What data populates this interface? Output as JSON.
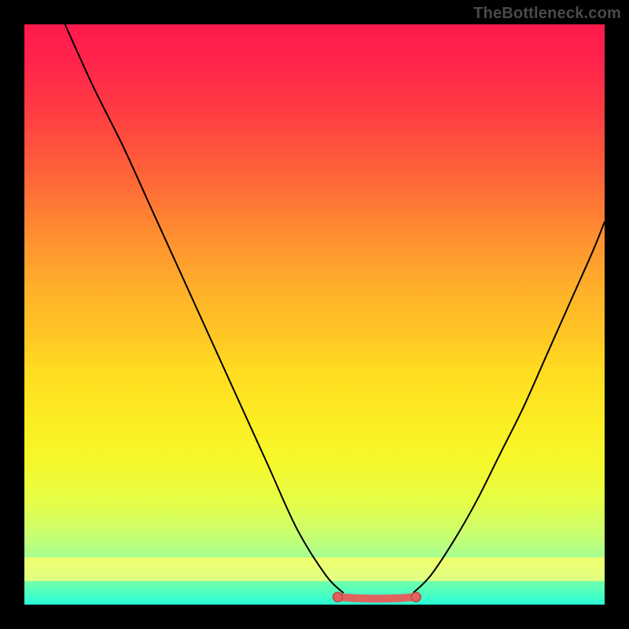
{
  "watermark": "TheBottleneck.com",
  "chart_data": {
    "type": "line",
    "title": "",
    "xlabel": "",
    "ylabel": "",
    "xlim": [
      0,
      100
    ],
    "ylim": [
      0,
      100
    ],
    "series": [
      {
        "name": "left-branch",
        "x": [
          7,
          12,
          17,
          22,
          27,
          32,
          37,
          42,
          47,
          52,
          55
        ],
        "y": [
          100,
          89,
          79,
          68,
          57,
          46,
          35,
          24,
          13,
          5,
          2
        ]
      },
      {
        "name": "right-branch",
        "x": [
          67,
          70,
          74,
          78,
          82,
          86,
          90,
          94,
          98,
          100
        ],
        "y": [
          2,
          5,
          11,
          18,
          26,
          34,
          43,
          52,
          61,
          66
        ]
      }
    ],
    "flat_segment": {
      "name": "bottom-plateau",
      "x_start": 54,
      "x_end": 67.5,
      "y": 1.3,
      "color": "#e0635f"
    },
    "background_gradient": {
      "top": "#ff1a4d",
      "mid": "#ffdc21",
      "bottom": "#29fed9"
    }
  }
}
